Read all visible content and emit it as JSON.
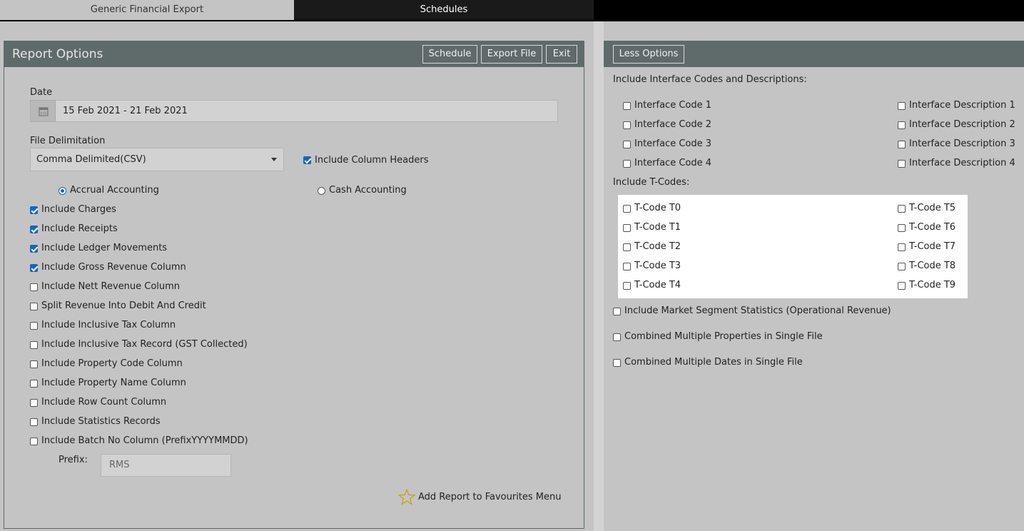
{
  "tabs": {
    "active": "Generic Financial Export",
    "inactive": "Schedules"
  },
  "left": {
    "panel_title": "Report Options",
    "buttons": {
      "schedule": "Schedule",
      "export": "Export File",
      "exit": "Exit"
    },
    "date_label": "Date",
    "date_value": "15 Feb 2021 - 21 Feb 2021",
    "delim_label": "File Delimitation",
    "delim_value": "Comma Delimited(CSV)",
    "include_headers": {
      "label": "Include Column Headers",
      "checked": true
    },
    "accrual": {
      "label": "Accrual Accounting",
      "selected": true
    },
    "cash": {
      "label": "Cash Accounting",
      "selected": false
    },
    "options": [
      {
        "label": "Include Charges",
        "checked": true
      },
      {
        "label": "Include Receipts",
        "checked": true
      },
      {
        "label": "Include Ledger Movements",
        "checked": true
      },
      {
        "label": "Include Gross Revenue Column",
        "checked": true
      },
      {
        "label": "Include Nett Revenue Column",
        "checked": false
      },
      {
        "label": "Split Revenue Into Debit And Credit",
        "checked": false
      },
      {
        "label": "Include Inclusive Tax Column",
        "checked": false
      },
      {
        "label": "Include Inclusive Tax Record (GST Collected)",
        "checked": false
      },
      {
        "label": "Include Property Code Column",
        "checked": false
      },
      {
        "label": "Include Property Name Column",
        "checked": false
      },
      {
        "label": "Include Row Count Column",
        "checked": false
      },
      {
        "label": "Include Statistics Records",
        "checked": false
      },
      {
        "label": "Include Batch No Column (PrefixYYYYMMDD)",
        "checked": false
      }
    ],
    "prefix_label": "Prefix:",
    "prefix_value": "RMS",
    "favourites": "Add Report to Favourites Menu"
  },
  "right": {
    "less_options": "Less Options",
    "interface_heading": "Include Interface Codes and Descriptions:",
    "interface_codes": [
      "Interface Code 1",
      "Interface Code 2",
      "Interface Code 3",
      "Interface Code 4"
    ],
    "interface_descs": [
      "Interface Description 1",
      "Interface Description 2",
      "Interface Description 3",
      "Interface Description 4"
    ],
    "tcodes_heading": "Include T-Codes:",
    "tcodes_left": [
      "T-Code T0",
      "T-Code T1",
      "T-Code T2",
      "T-Code T3",
      "T-Code T4"
    ],
    "tcodes_right": [
      "T-Code T5",
      "T-Code T6",
      "T-Code T7",
      "T-Code T8",
      "T-Code T9"
    ],
    "extra": [
      "Include Market Segment Statistics (Operational Revenue)",
      "Combined Multiple Properties in Single File",
      "Combined Multiple Dates in Single File"
    ]
  },
  "colors": {
    "header": "#5f6b6a",
    "accent": "#1565c0",
    "background": "#c4c4c4"
  },
  "icons": {
    "date": "calendar-icon",
    "select": "caret-down-icon",
    "favourite": "star-outline-icon"
  }
}
